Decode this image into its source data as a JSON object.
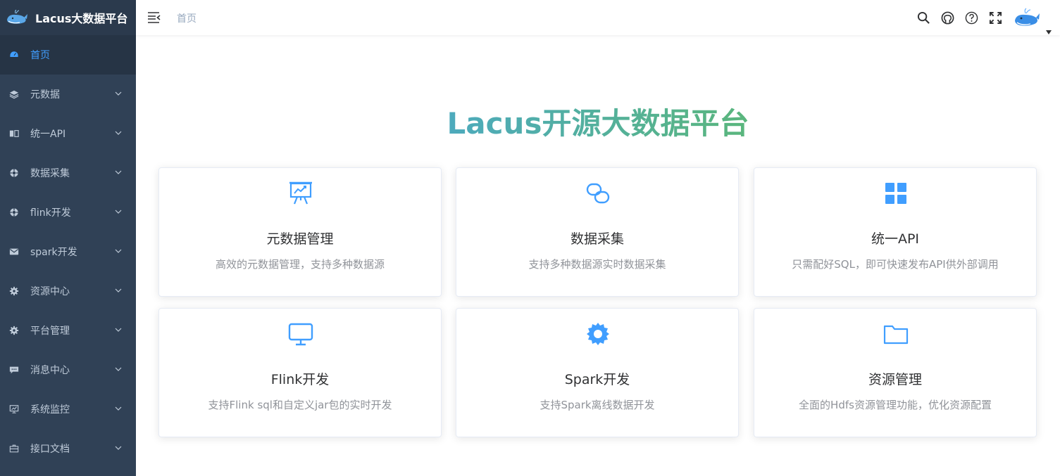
{
  "app": {
    "title": "Lacus大数据平台",
    "logo_icon": "whale-logo-icon"
  },
  "sidebar": {
    "items": [
      {
        "label": "首页",
        "icon": "dashboard-icon",
        "active": true
      },
      {
        "label": "元数据",
        "icon": "layers-icon"
      },
      {
        "label": "统一API",
        "icon": "book-icon"
      },
      {
        "label": "数据采集",
        "icon": "lifebuoy-icon"
      },
      {
        "label": "flink开发",
        "icon": "lifebuoy-icon"
      },
      {
        "label": "spark开发",
        "icon": "mail-icon"
      },
      {
        "label": "资源中心",
        "icon": "gear-icon"
      },
      {
        "label": "平台管理",
        "icon": "gear-icon"
      },
      {
        "label": "消息中心",
        "icon": "chat-icon"
      },
      {
        "label": "系统监控",
        "icon": "monitor-icon"
      },
      {
        "label": "接口文档",
        "icon": "briefcase-icon"
      }
    ]
  },
  "navbar": {
    "breadcrumb": "首页",
    "icons": [
      "search-icon",
      "github-icon",
      "question-icon",
      "fullscreen-icon"
    ]
  },
  "main": {
    "hero_title": "Lacus开源大数据平台",
    "accent_colors": [
      "#409eff",
      "#67c23a"
    ],
    "cards": [
      {
        "icon": "presentation-chart-icon",
        "title": "元数据管理",
        "desc": "高效的元数据管理，支持多种数据源"
      },
      {
        "icon": "link-icon",
        "title": "数据采集",
        "desc": "支持多种数据源实时数据采集"
      },
      {
        "icon": "grid-icon",
        "title": "统一API",
        "desc": "只需配好SQL，即可快速发布API供外部调用"
      },
      {
        "icon": "monitor-icon",
        "title": "Flink开发",
        "desc": "支持Flink sql和自定义jar包的实时开发"
      },
      {
        "icon": "gear-icon",
        "title": "Spark开发",
        "desc": "支持Spark离线数据开发"
      },
      {
        "icon": "folder-icon",
        "title": "资源管理",
        "desc": "全面的Hdfs资源管理功能，优化资源配置"
      }
    ]
  }
}
